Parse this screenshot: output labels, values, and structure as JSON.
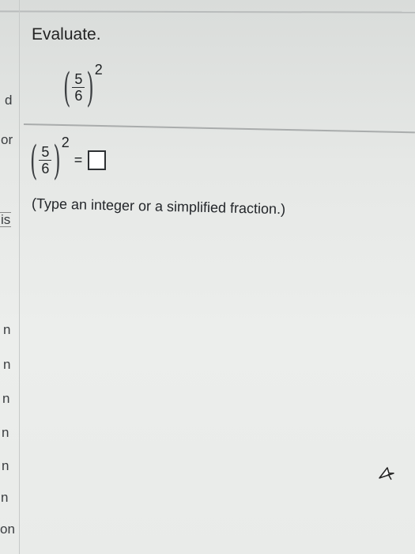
{
  "question": {
    "instruction": "Evaluate.",
    "expression": {
      "numerator": "5",
      "denominator": "6",
      "exponent": "2"
    }
  },
  "answer": {
    "expression": {
      "numerator": "5",
      "denominator": "6",
      "exponent": "2"
    },
    "equals": "=",
    "hint": "(Type an integer or a simplified fraction.)"
  },
  "left_sidebar": {
    "fragments": [
      "d",
      "or",
      "is",
      "n",
      "n",
      "n",
      "n",
      "n",
      "n",
      "on"
    ]
  },
  "icons": {
    "cursor": "mouse-pointer-icon"
  }
}
